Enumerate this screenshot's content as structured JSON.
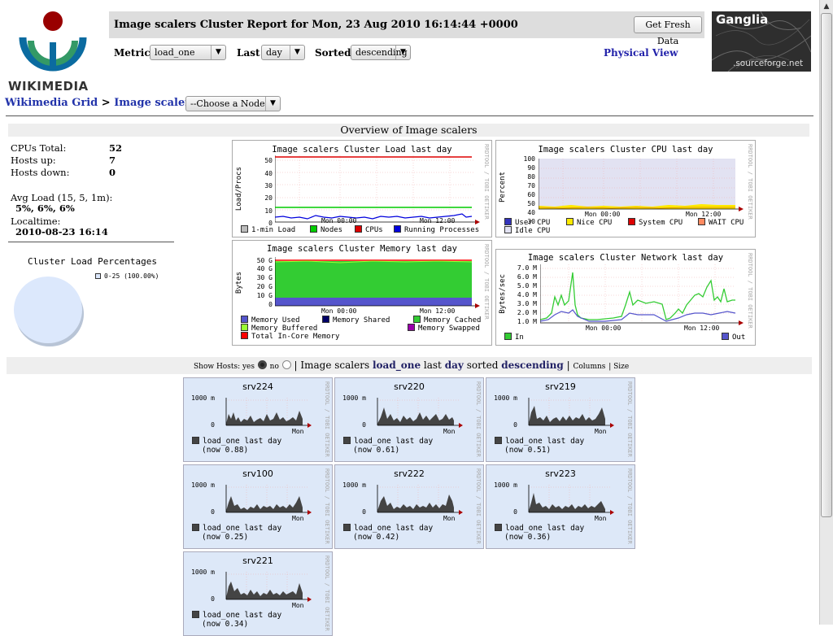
{
  "header": {
    "title": "Image scalers Cluster Report for Mon, 23 Aug 2010 16:14:44 +0000",
    "fresh_button": "Get Fresh Data",
    "logo_text": "WIKIMEDIA",
    "ganglia_logo_title": "Ganglia",
    "ganglia_logo_sub": ".sourceforge.net",
    "metric_label": "Metric",
    "metric_value": "load_one",
    "last_label": "Last",
    "last_value": "day",
    "sorted_label": "Sorted",
    "sorted_value": "descending",
    "physical_view": "Physical View"
  },
  "breadcrumb": {
    "grid": "Wikimedia Grid",
    "sep1": ">",
    "cluster": "Image scalers",
    "sep2": ">",
    "node_select": "--Choose a Node"
  },
  "overview": {
    "title": "Overview of Image scalers",
    "cpus_label": "CPUs Total:",
    "cpus_value": "52",
    "hosts_up_label": "Hosts up:",
    "hosts_up_value": "7",
    "hosts_down_label": "Hosts down:",
    "hosts_down_value": "0",
    "avg_load_label": "Avg Load (15, 5, 1m):",
    "avg_load_value": "5%, 6%, 6%",
    "localtime_label": "Localtime:",
    "localtime_value": "2010-08-23 16:14",
    "pie_title": "Cluster Load Percentages",
    "pie_legend": "0-25 (100.00%)",
    "pie_color": "#dce8fc"
  },
  "graphs": {
    "rrdtool": "RRDTOOL / TOBI OETIKER",
    "load": {
      "title": "Image scalers Cluster Load last day",
      "ylabel": "Load/Procs",
      "yticks": [
        "50",
        "40",
        "30",
        "20",
        "10",
        "0"
      ],
      "xticks": [
        "Mon 00:00",
        "Mon 12:00"
      ],
      "legend": [
        "1-min Load",
        "Nodes",
        "CPUs",
        "Running Processes"
      ],
      "colors": [
        "#bbbbbb",
        "#00cc00",
        "#dd0000",
        "#0000dd"
      ]
    },
    "cpu": {
      "title": "Image scalers Cluster CPU last day",
      "ylabel": "Percent",
      "yticks": [
        "100",
        "90",
        "80",
        "70",
        "60",
        "50",
        "40",
        "30",
        "20",
        "10",
        "0"
      ],
      "xticks": [
        "Mon 00:00",
        "Mon 12:00"
      ],
      "legend": [
        "User CPU",
        "Nice CPU",
        "System CPU",
        "WAIT CPU",
        "Idle CPU"
      ],
      "colors": [
        "#3333bb",
        "#ffea00",
        "#dd0000",
        "#ff8a60",
        "#e2e2f2"
      ]
    },
    "memory": {
      "title": "Image scalers Cluster Memory last day",
      "ylabel": "Bytes",
      "yticks": [
        "50 G",
        "40 G",
        "30 G",
        "20 G",
        "10 G",
        "0"
      ],
      "xticks": [
        "Mon 00:00",
        "Mon 12:00"
      ],
      "legend": [
        "Memory Used",
        "Memory Shared",
        "Memory Cached",
        "Memory Buffered",
        "Memory Swapped",
        "Total In-Core Memory"
      ],
      "colors": [
        "#5555cc",
        "#000066",
        "#33cc33",
        "#99ff33",
        "#9900aa",
        "#ff0000"
      ]
    },
    "network": {
      "title": "Image scalers Cluster Network last day",
      "ylabel": "Bytes/sec",
      "yticks": [
        "7.0 M",
        "6.0 M",
        "5.0 M",
        "4.0 M",
        "3.0 M",
        "2.0 M",
        "1.0 M",
        "0"
      ],
      "xticks": [
        "Mon 00:00",
        "Mon 12:00"
      ],
      "legend": [
        "In",
        "Out"
      ],
      "colors": [
        "#33cc33",
        "#5555cc"
      ]
    }
  },
  "hosts_bar": {
    "show_hosts": "Show Hosts: yes",
    "no": "no",
    "sep": "|",
    "cluster": "Image scalers",
    "metric": "load_one",
    "last_word": "last",
    "range": "day",
    "sorted_word": "sorted",
    "order": "descending",
    "columns": "Columns",
    "size": "| Size"
  },
  "hosts": [
    {
      "name": "srv224",
      "ytop": "1000 m",
      "ybot": "0",
      "xlabel": "Mon",
      "legend": "load_one last day",
      "now": "(now 0.88)"
    },
    {
      "name": "srv220",
      "ytop": "1000 m",
      "ybot": "0",
      "xlabel": "Mon",
      "legend": "load_one last day",
      "now": "(now 0.61)"
    },
    {
      "name": "srv219",
      "ytop": "1000 m",
      "ybot": "0",
      "xlabel": "Mon",
      "legend": "load_one last day",
      "now": "(now 0.51)"
    },
    {
      "name": "srv100",
      "ytop": "1000 m",
      "ybot": "0",
      "xlabel": "Mon",
      "legend": "load_one last day",
      "now": "(now 0.25)"
    },
    {
      "name": "srv222",
      "ytop": "1000 m",
      "ybot": "0",
      "xlabel": "Mon",
      "legend": "load_one last day",
      "now": "(now 0.42)"
    },
    {
      "name": "srv223",
      "ytop": "1000 m",
      "ybot": "0",
      "xlabel": "Mon",
      "legend": "load_one last day",
      "now": "(now 0.36)"
    },
    {
      "name": "srv221",
      "ytop": "1000 m",
      "ybot": "0",
      "xlabel": "Mon",
      "legend": "load_one last day",
      "now": "(now 0.34)"
    }
  ],
  "chart_data": [
    {
      "type": "pie",
      "title": "Cluster Load Percentages",
      "categories": [
        "0-25"
      ],
      "values": [
        100.0
      ]
    },
    {
      "type": "line",
      "title": "Image scalers Cluster Load last day",
      "ylabel": "Load/Procs",
      "ylim": [
        0,
        55
      ],
      "series": [
        {
          "name": "CPUs",
          "values": [
            52
          ]
        },
        {
          "name": "Nodes",
          "values": [
            7
          ]
        },
        {
          "name": "1-min Load",
          "values": [
            3
          ]
        },
        {
          "name": "Running Processes",
          "values": [
            3
          ]
        }
      ]
    },
    {
      "type": "area",
      "title": "Image scalers Cluster CPU last day",
      "ylabel": "Percent",
      "ylim": [
        0,
        100
      ],
      "series": [
        {
          "name": "User CPU",
          "values": [
            3
          ]
        },
        {
          "name": "Idle CPU",
          "values": [
            95
          ]
        }
      ]
    },
    {
      "type": "area",
      "title": "Image scalers Cluster Memory last day",
      "ylabel": "Bytes",
      "ylim": [
        0,
        52
      ],
      "series": [
        {
          "name": "Memory Used",
          "values": [
            5
          ]
        },
        {
          "name": "Memory Cached",
          "values": [
            44
          ]
        },
        {
          "name": "Total In-Core Memory",
          "values": [
            50
          ]
        }
      ]
    },
    {
      "type": "line",
      "title": "Image scalers Cluster Network last day",
      "ylabel": "Bytes/sec",
      "ylim": [
        0,
        7.2
      ],
      "series": [
        {
          "name": "In",
          "values": [
            0.5,
            3.5,
            6.6,
            0.3,
            0.3,
            2.6,
            2.0,
            0.4,
            4.2,
            6.4,
            3.8
          ]
        },
        {
          "name": "Out",
          "values": [
            0.4,
            1.3,
            1.5,
            0.2,
            0.2,
            1.1,
            0.9,
            0.2,
            1.2,
            1.4,
            1.1
          ]
        }
      ]
    }
  ]
}
